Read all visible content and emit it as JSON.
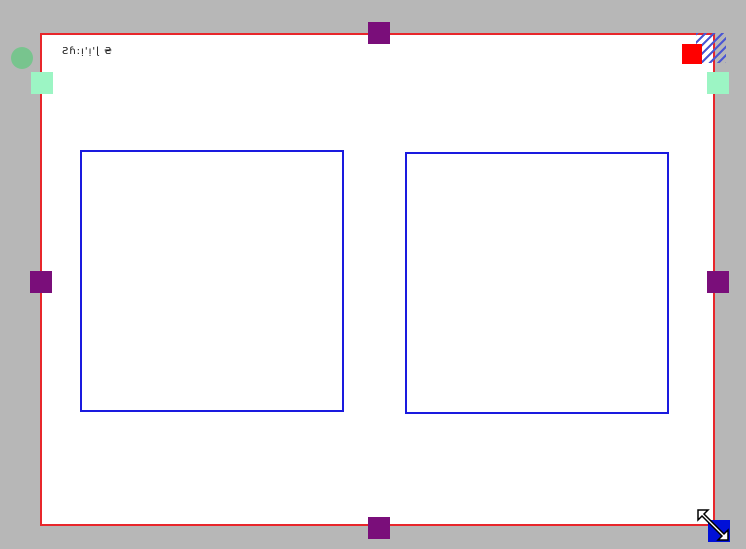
{
  "caption": {
    "text": "Ƨɦ:ᴉ'ᴉ'ɭ ₴"
  },
  "icons": {
    "rotate": "rotate-handle-icon",
    "delete": "delete-icon",
    "resize": "resize-diagonal-icon"
  },
  "colors": {
    "canvas_border": "#e8262b",
    "frame_border": "#1a1adf",
    "mid_handle": "#7a0e7a",
    "corner_handle": "#9cf5c4",
    "delete_handle": "#ff0000",
    "rotate_handle": "#78c48e",
    "resize_handle": "#0010d8",
    "workspace": "#b7b7b7"
  }
}
